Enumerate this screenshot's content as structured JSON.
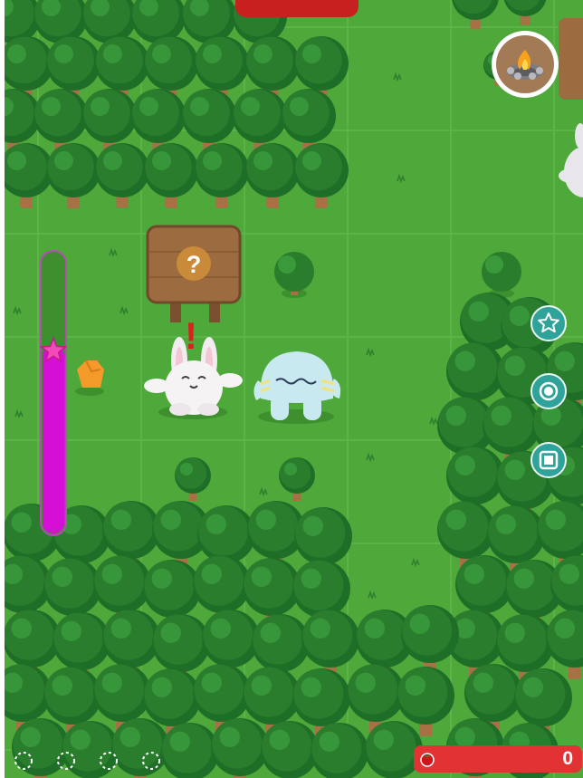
{
  "hud": {
    "tomato_count": "0",
    "sign_symbol": "?",
    "alert_symbol": "!"
  },
  "meter": {
    "level": 0.67
  },
  "progress_dots": {
    "filled": 0,
    "total": 4
  },
  "icons": {
    "campfire": "campfire-icon",
    "favorite": "star-icon",
    "record": "record-icon",
    "stop": "stop-icon",
    "tomato": "tomato-icon"
  },
  "colors": {
    "grass": "#4fa83a",
    "grass_tile_border": "#5fb94a",
    "tree_canopy": "#2a7d2d",
    "tree_trunk": "#a87145",
    "meter_fill": "#d60fd6",
    "meter_star": "#f24ab8",
    "tomato_bar": "#e23234",
    "top_bar": "#c8201f",
    "action_button": "#2fa39a",
    "sign_wood": "#9c6b3f"
  }
}
